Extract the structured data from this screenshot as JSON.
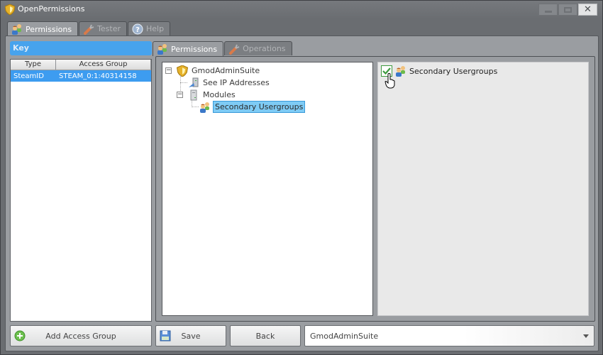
{
  "window": {
    "title": "OpenPermissions",
    "controls": {
      "minimize": "minimize",
      "maximize": "maximize",
      "close": "✕"
    }
  },
  "top_tabs": [
    {
      "label": "Permissions",
      "icon": "users-icon",
      "active": true
    },
    {
      "label": "Tester",
      "icon": "wrench-icon",
      "active": false
    },
    {
      "label": "Help",
      "icon": "help-icon",
      "active": false
    }
  ],
  "key_panel": {
    "header": "Key",
    "columns": [
      "Type",
      "Access Group"
    ],
    "rows": [
      {
        "type": "SteamID",
        "access_group": "STEAM_0:1:40314158",
        "selected": true
      }
    ]
  },
  "inner_tabs": [
    {
      "label": "Permissions",
      "icon": "users-icon",
      "active": true
    },
    {
      "label": "Operations",
      "icon": "wrench-icon",
      "active": false
    }
  ],
  "tree": {
    "root": {
      "label": "GmodAdminSuite",
      "icon": "shield-icon",
      "expanded": true
    },
    "children": [
      {
        "label": "See IP Addresses",
        "icon": "network-icon"
      },
      {
        "label": "Modules",
        "icon": "server-icon",
        "expanded": true,
        "children": [
          {
            "label": "Secondary Usergroups",
            "icon": "users-icon",
            "selected": true
          }
        ]
      }
    ],
    "expander_symbol": "−"
  },
  "detail": {
    "items": [
      {
        "label": "Secondary Usergroups",
        "checked": true,
        "icon": "users-icon"
      }
    ]
  },
  "buttons": {
    "add_access_group": "Add Access Group",
    "save": "Save",
    "back": "Back"
  },
  "addon_select": {
    "value": "GmodAdminSuite"
  },
  "colors": {
    "accent": "#47a3ed",
    "selection": "#3d9cf0",
    "tree_selection": "#7ecbf5",
    "check": "#3d9a3f"
  }
}
